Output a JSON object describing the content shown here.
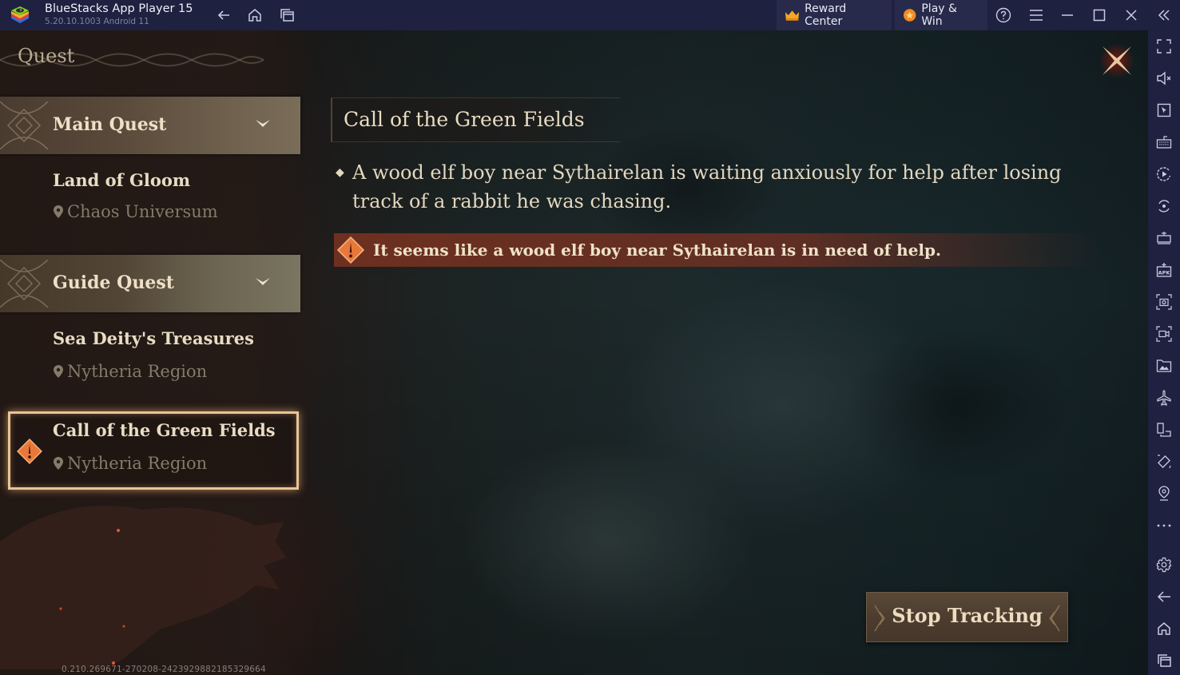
{
  "titlebar": {
    "app_name": "BlueStacks App Player 15",
    "version": "5.20.10.1003  Android 11",
    "reward_center_label": "Reward Center",
    "play_win_label": "Play & Win",
    "icons": [
      "back-arrow",
      "home",
      "recent-apps",
      "help",
      "menu",
      "minimize",
      "maximize",
      "close",
      "collapse-sidebar"
    ]
  },
  "right_sidebar": {
    "icons": [
      "fullscreen",
      "volume-muted",
      "pointer",
      "keyboard-controls",
      "macro-play",
      "sync-rotate",
      "performance",
      "install-apk",
      "screenshot",
      "screen-record",
      "media-folder",
      "airplane-mode",
      "multi-instance",
      "rotate",
      "location",
      "more",
      "settings",
      "back",
      "home",
      "recent-apps"
    ]
  },
  "game": {
    "panel_title": "Quest",
    "categories": [
      {
        "label": "Main Quest",
        "quests": [
          {
            "name": "Land of Gloom",
            "region": "Chaos Universum",
            "active": false
          }
        ]
      },
      {
        "label": "Guide Quest",
        "quests": [
          {
            "name": "Sea Deity's Treasures",
            "region": "Nytheria Region",
            "active": false
          },
          {
            "name": "Call of the Green Fields",
            "region": "Nytheria Region",
            "active": true
          }
        ]
      }
    ],
    "detail": {
      "title": "Call of the Green Fields",
      "description": "A wood elf boy near Sythairelan is waiting anxiously for help after losing track of a rabbit he was chasing.",
      "hint": "It seems like a wood elf boy near Sythairelan is in need of help."
    },
    "stop_tracking_label": "Stop Tracking",
    "build_id": "0.210.269671-270208-2423929882185329664",
    "colors": {
      "text_cream": "#e8dcc3",
      "region_muted": "#867a6a",
      "hint_bar": "#783220",
      "alert_orange": "#e8783a",
      "active_border": "#e8c497"
    }
  }
}
